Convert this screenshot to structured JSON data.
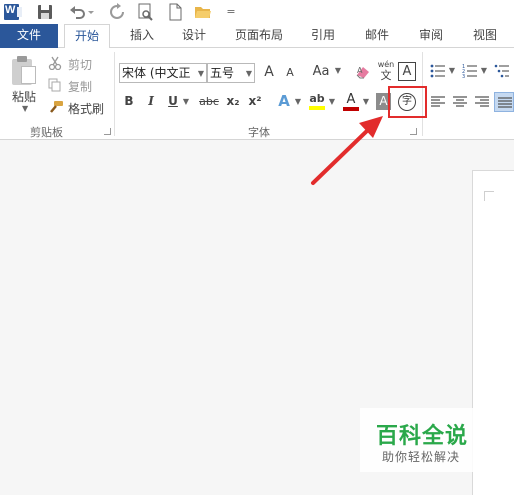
{
  "quick_access": {
    "app_icon": "word-icon",
    "app_letter": "W",
    "items": [
      "save-icon",
      "undo-icon",
      "redo-icon",
      "print-preview-icon",
      "new-document-icon",
      "open-folder-icon",
      "customize-icon"
    ],
    "customize_glyph": "="
  },
  "tabs": [
    {
      "label": "文件"
    },
    {
      "label": "开始"
    },
    {
      "label": "插入"
    },
    {
      "label": "设计"
    },
    {
      "label": "页面布局"
    },
    {
      "label": "引用"
    },
    {
      "label": "邮件"
    },
    {
      "label": "审阅"
    },
    {
      "label": "视图"
    }
  ],
  "clipboard": {
    "paste_label": "粘贴",
    "cut_label": "剪切",
    "copy_label": "复制",
    "format_painter_label": "格式刷",
    "group_label": "剪贴板"
  },
  "font": {
    "font_name": "宋体 (中文正",
    "font_size": "五号",
    "grow_glyph": "A",
    "shrink_glyph": "A",
    "case_glyph": "Aa",
    "phonetic_top": "wén",
    "phonetic_bottom": "文",
    "border_glyph": "A",
    "bold": "B",
    "italic": "I",
    "underline": "U",
    "strike": "abc",
    "sub": "x₂",
    "sup": "x²",
    "text_effect_glyph": "A",
    "highlight_glyph": "ab",
    "font_color_glyph": "A",
    "shading_glyph": "A",
    "enclose_char_glyph": "字",
    "group_label": "字体"
  },
  "colors": {
    "accent": "#2b579a",
    "highlight_box": "#e22c2c",
    "arrow": "#e22c2c",
    "font_color_bar": "#c00000",
    "highlight_bar": "#ffff00",
    "watermark_title": "#2aa84a"
  },
  "watermark": {
    "title": "百科全说",
    "subtitle": "助你轻松解决"
  }
}
